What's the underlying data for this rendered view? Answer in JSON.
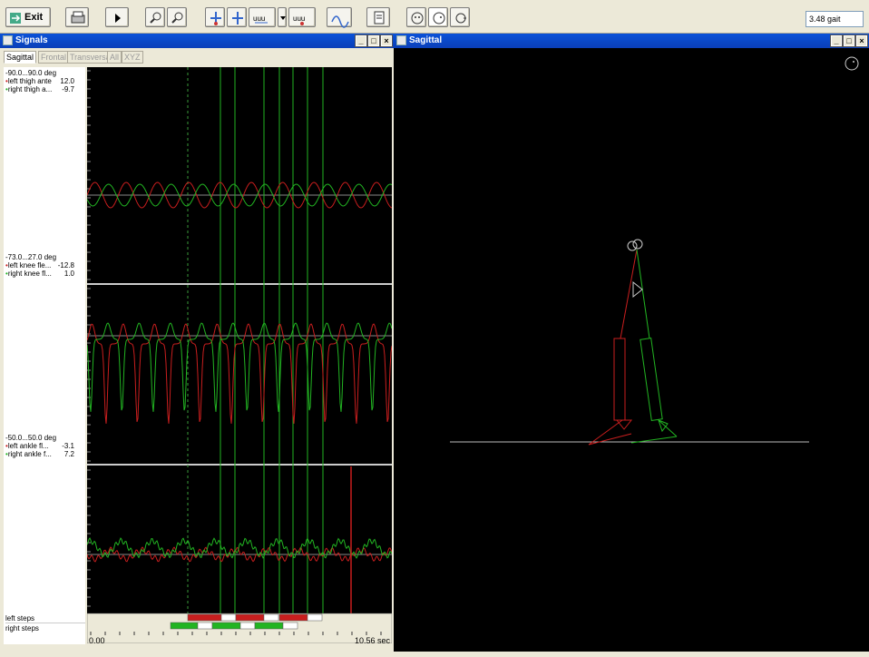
{
  "toolbar": {
    "exit_label": "Exit",
    "status_text": "3.48 gait"
  },
  "signals_window": {
    "title": "Signals",
    "tabs": [
      {
        "label": "Sagittal",
        "active": true
      },
      {
        "label": "Frontal",
        "active": false
      },
      {
        "label": "Transversal",
        "active": false
      },
      {
        "label": "All",
        "active": false
      },
      {
        "label": "XYZ",
        "active": false
      }
    ],
    "panels": [
      {
        "range": "-90.0...90.0 deg",
        "series": [
          {
            "name": "left thigh ante",
            "value": "12.0",
            "color": "#d02020"
          },
          {
            "name": "right thigh a...",
            "value": "-9.7",
            "color": "#20a020"
          }
        ]
      },
      {
        "range": "-73.0...27.0 deg",
        "series": [
          {
            "name": "left knee fle...",
            "value": "-12.8",
            "color": "#d02020"
          },
          {
            "name": "right knee fl...",
            "value": "1.0",
            "color": "#20a020"
          }
        ]
      },
      {
        "range": "-50.0...50.0 deg",
        "series": [
          {
            "name": "left ankle fl...",
            "value": "-3.1",
            "color": "#d02020"
          },
          {
            "name": "right ankle f...",
            "value": "7.2",
            "color": "#20a020"
          }
        ]
      }
    ],
    "steps": {
      "left_label": "left steps",
      "right_label": "right steps"
    },
    "time_axis": {
      "start": "0.00",
      "end": "10.56 sec"
    }
  },
  "sagittal_window": {
    "title": "Sagittal"
  },
  "colors": {
    "left": "#c81e1e",
    "right": "#22b422",
    "titlebar": "#0a52d8"
  }
}
